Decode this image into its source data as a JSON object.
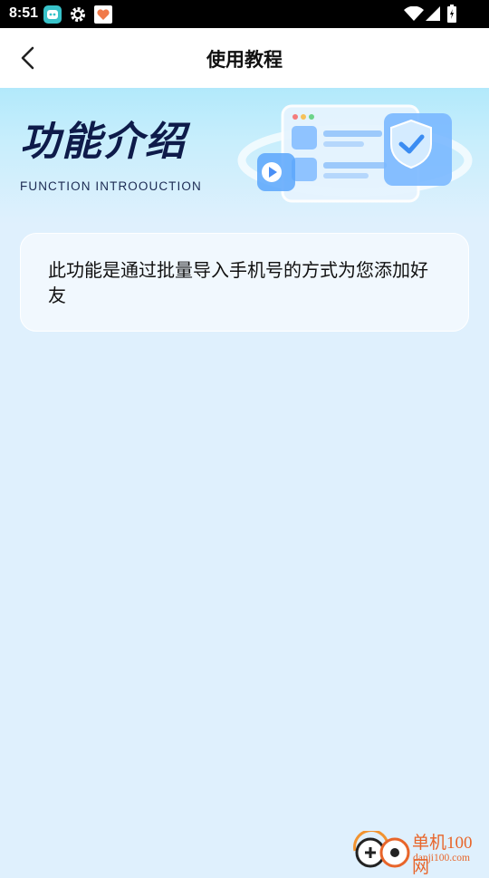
{
  "status_bar": {
    "time": "8:51",
    "left_icons": [
      "app-notification-icon",
      "gear-icon",
      "heart-app-icon"
    ],
    "right_icons": [
      "wifi-icon",
      "cellular-signal-icon",
      "battery-icon"
    ]
  },
  "header": {
    "back_icon": "chevron-left-icon",
    "title": "使用教程"
  },
  "banner": {
    "title": "功能介绍",
    "subtitle": "FUNCTION INTROOUCTION"
  },
  "card": {
    "text": "此功能是通过批量导入手机号的方式为您添加好友"
  },
  "watermark": {
    "name": "单机100网",
    "url": "danji100.com"
  },
  "colors": {
    "background": "#dff0fd",
    "banner_title": "#0e1b4a",
    "watermark": "#e8652a"
  }
}
